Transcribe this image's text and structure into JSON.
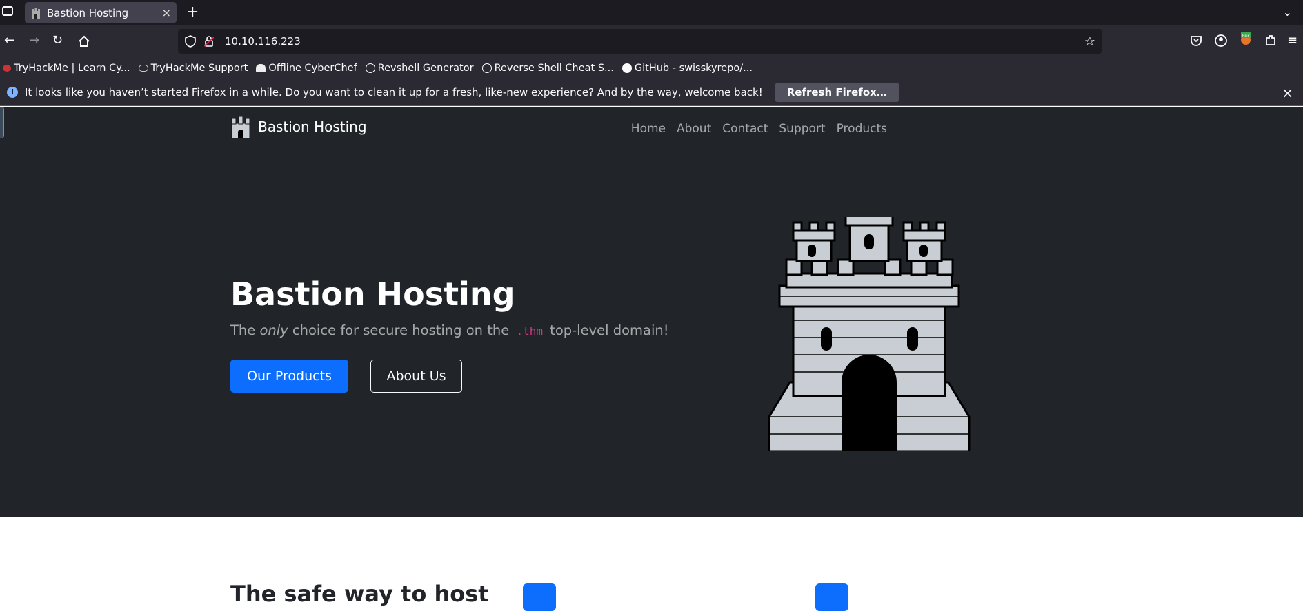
{
  "browser": {
    "tab_title": "Bastion Hosting",
    "tab_close": "×",
    "new_tab": "+",
    "url": "10.10.116.223",
    "bookmarks": [
      {
        "label": "TryHackMe | Learn Cy...",
        "icon": "thm-icon"
      },
      {
        "label": "TryHackMe Support",
        "icon": "cloud-icon"
      },
      {
        "label": "Offline CyberChef",
        "icon": "chef-icon"
      },
      {
        "label": "Revshell Generator",
        "icon": "globe-icon"
      },
      {
        "label": "Reverse Shell Cheat S...",
        "icon": "globe-icon"
      },
      {
        "label": "GitHub - swisskyrepo/...",
        "icon": "github-icon"
      }
    ],
    "notice": {
      "text": "It looks like you haven’t started Firefox in a while. Do you want to clean it up for a fresh, like-new experience? And by the way, welcome back!",
      "button": "Refresh Firefox…",
      "close": "×"
    }
  },
  "site": {
    "brand": "Bastion Hosting",
    "nav": [
      "Home",
      "About",
      "Contact",
      "Support",
      "Products"
    ],
    "hero": {
      "title": "Bastion Hosting",
      "sub_pre": "The ",
      "sub_em": "only",
      "sub_mid": " choice for secure hosting on the ",
      "sub_code": ".thm",
      "sub_post": " top-level domain!",
      "btn_primary": "Our Products",
      "btn_secondary": "About Us"
    },
    "section_title": "The safe way to host"
  },
  "colors": {
    "hero_bg": "#212529",
    "primary": "#0d6efd",
    "code": "#d63384"
  }
}
